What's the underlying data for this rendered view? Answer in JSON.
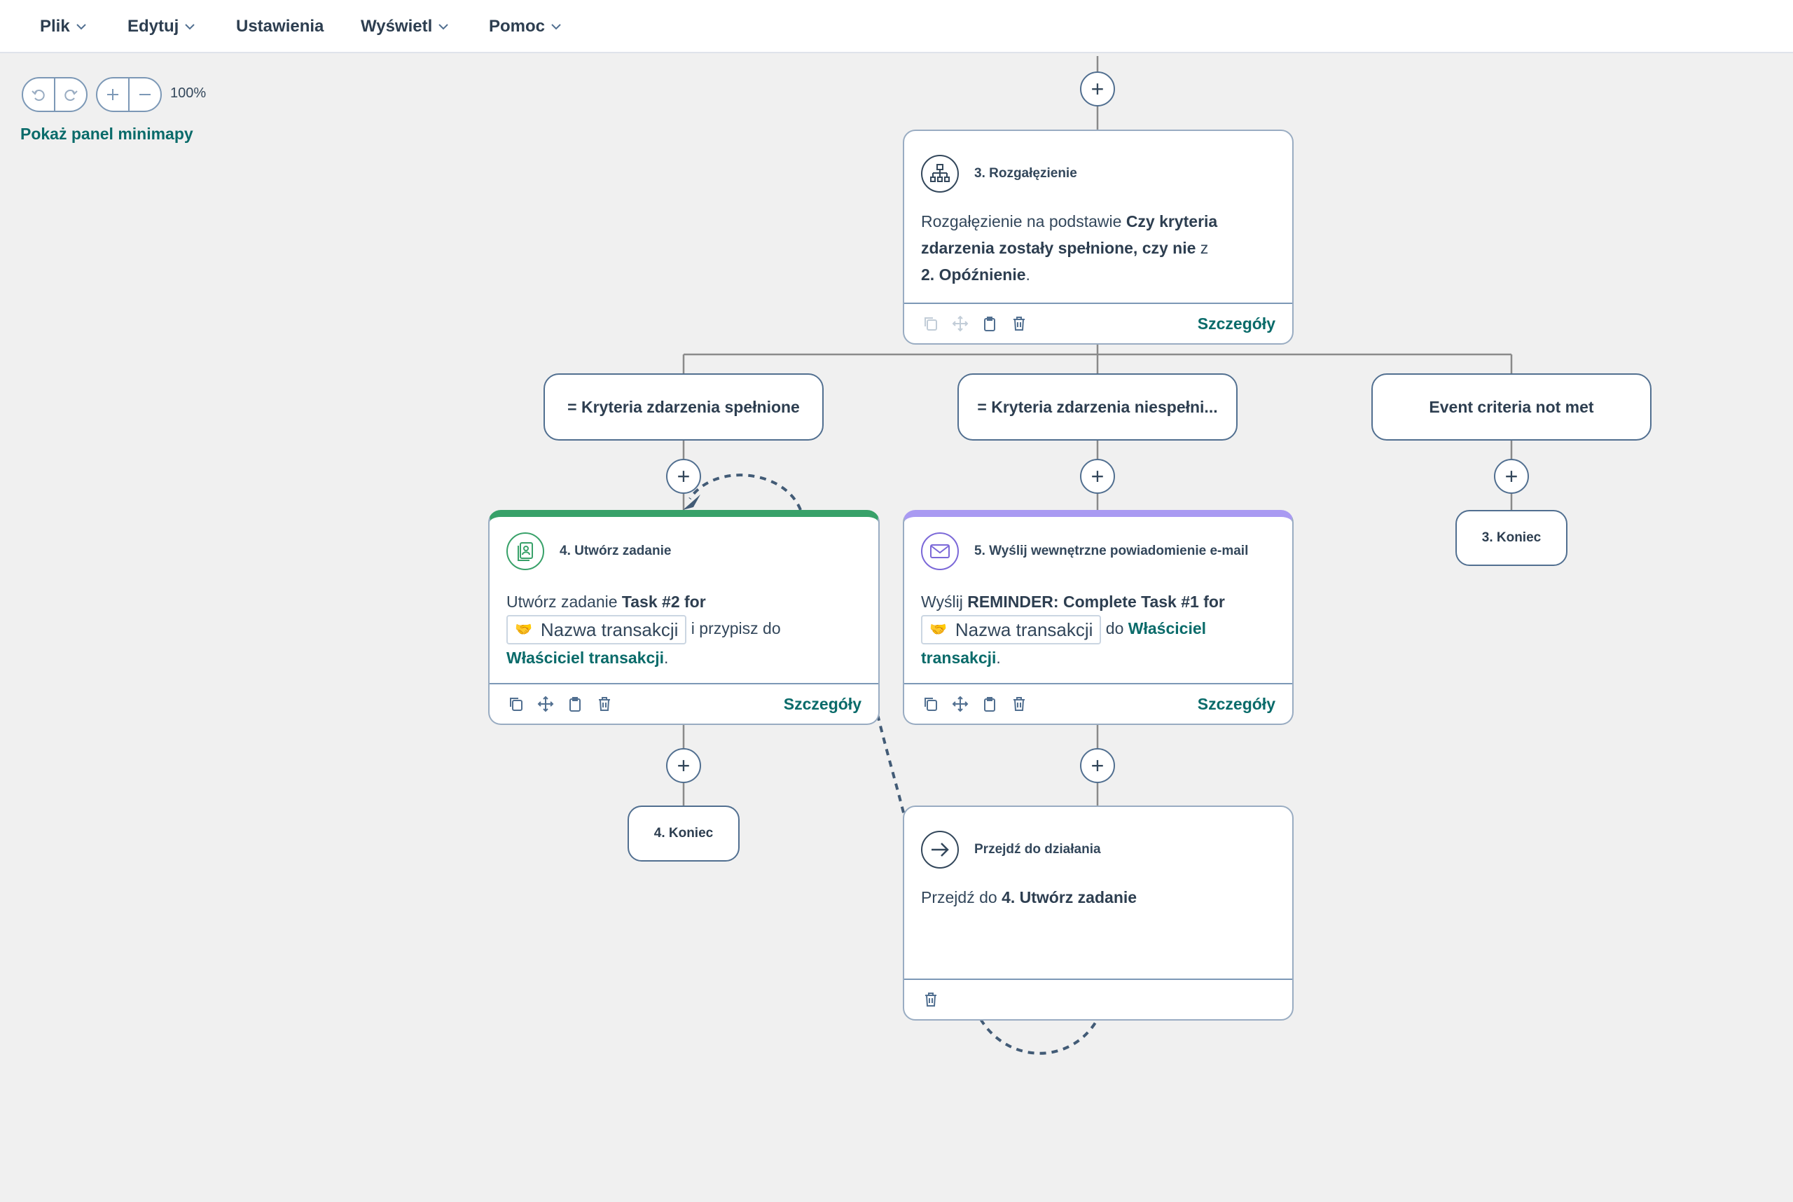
{
  "menu": [
    {
      "label": "Plik",
      "has_dropdown": true
    },
    {
      "label": "Edytuj",
      "has_dropdown": true
    },
    {
      "label": "Ustawienia",
      "has_dropdown": false
    },
    {
      "label": "Wyświetl",
      "has_dropdown": true
    },
    {
      "label": "Pomoc",
      "has_dropdown": true
    }
  ],
  "toolbar": {
    "undo_icon": "undo-icon",
    "redo_icon": "redo-icon",
    "zoom_in_icon": "zoom-in-icon",
    "zoom_out_icon": "zoom-out-icon",
    "zoom_level": "100%",
    "minimap_link": "Pokaż panel minimapy"
  },
  "branch_card": {
    "title": "3. Rozgałęzienie",
    "body_prefix": "Rozgałęzienie na podstawie ",
    "body_bold": "Czy kryteria zdarzenia zostały spełnione, czy nie",
    "body_mid": " z ",
    "body_ref": "2. Opóźnienie",
    "body_end": ".",
    "details": "Szczegóły"
  },
  "branches": [
    {
      "label": "= Kryteria zdarzenia spełnione"
    },
    {
      "label": "= Kryteria zdarzenia niespełni..."
    },
    {
      "label": "Event criteria not met"
    }
  ],
  "task_card": {
    "title": "4. Utwórz zadanie",
    "accent_color": "#38a169",
    "body_prefix": "Utwórz zadanie ",
    "task_name": "Task #2 for",
    "token": "Nazwa transakcji",
    "assign_text": " i przypisz do",
    "owner_link": "Właściciel transakcji",
    "body_end": ".",
    "details": "Szczegóły"
  },
  "email_card": {
    "title": "5. Wyślij wewnętrzne powiadomienie e-mail",
    "accent_color": "#a99af2",
    "body_prefix": "Wyślij ",
    "subject": "REMINDER: Complete Task #1 for",
    "token": "Nazwa transakcji",
    "to_text": " do ",
    "owner_link_1": "Właściciel",
    "owner_link_2": "transakcji",
    "body_end": ".",
    "details": "Szczegóły"
  },
  "goto_card": {
    "title": "Przejdź do działania",
    "body_prefix": "Przejdź do ",
    "target": "4. Utwórz zadanie"
  },
  "end_nodes": [
    {
      "label": "3. Koniec"
    },
    {
      "label": "4. Koniec"
    }
  ],
  "colors": {
    "canvas": "#f0f0f0",
    "link": "#0a6b6a",
    "connector": "#7c98b6",
    "goto_arrow": "#425b76"
  }
}
